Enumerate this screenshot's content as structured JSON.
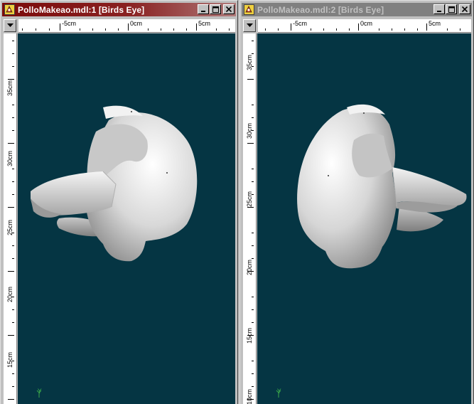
{
  "windows": [
    {
      "title": "PolloMakeao.mdl:1 [Birds Eye]",
      "active": true,
      "ruler_h": [
        "-5cm",
        "0cm",
        "5cm"
      ],
      "ruler_v": [
        "35cm",
        "30cm",
        "25cm",
        "20cm",
        "15cm"
      ],
      "axis_label": "Y"
    },
    {
      "title": "PolloMakeao.mdl:2 [Birds Eye]",
      "active": false,
      "ruler_h": [
        "-5cm",
        "0cm",
        "5cm"
      ],
      "ruler_v": [
        "35cm",
        "30cm",
        "25cm",
        "20cm",
        "15cm",
        "10cm"
      ],
      "axis_label": "Y"
    }
  ],
  "colors": {
    "viewport_bg": "#053543",
    "active_title": "#7b0a0a",
    "inactive_title": "#808080",
    "model": "#d8d8d8"
  },
  "icons": [
    "app-icon",
    "minimize-icon",
    "maximize-icon",
    "close-icon",
    "dropdown-arrow-icon"
  ]
}
